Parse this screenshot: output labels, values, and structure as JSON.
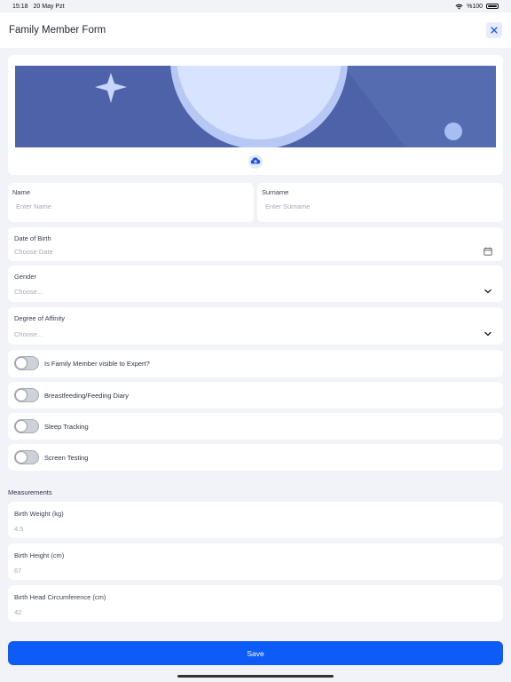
{
  "status_bar": {
    "time": "15:18",
    "date": "20 May Pzt",
    "battery": "%100"
  },
  "header": {
    "title": "Family Member Form"
  },
  "fields": {
    "name": {
      "label": "Name",
      "placeholder": "Enter Name"
    },
    "surname": {
      "label": "Surname",
      "placeholder": "Enter Surname"
    },
    "dob": {
      "label": "Date of Birth",
      "placeholder": "Choose Date"
    },
    "gender": {
      "label": "Gender",
      "placeholder": "Choose..."
    },
    "affinity": {
      "label": "Degree of Affinity",
      "placeholder": "Choose..."
    }
  },
  "toggles": [
    {
      "label": "Is Family Member visible to Expert?",
      "on": false
    },
    {
      "label": "Breastfeeding/Feeding Diary",
      "on": false
    },
    {
      "label": "Sleep Tracking",
      "on": false
    },
    {
      "label": "Screen Testing",
      "on": false
    }
  ],
  "measurements": {
    "title": "Measurements",
    "items": [
      {
        "label": "Birth Weight (kg)",
        "value": "4.5"
      },
      {
        "label": "Birth Height (cm)",
        "value": "67"
      },
      {
        "label": "Birth Head Circumference (cm)",
        "value": "42"
      }
    ]
  },
  "save_label": "Save",
  "colors": {
    "primary": "#0d5cf8",
    "banner": "#4d62a8",
    "background": "#f2f3f8"
  },
  "icons": [
    "close-icon",
    "upload-cloud-icon",
    "calendar-icon",
    "chevron-down-icon",
    "wifi-icon",
    "battery-icon"
  ]
}
